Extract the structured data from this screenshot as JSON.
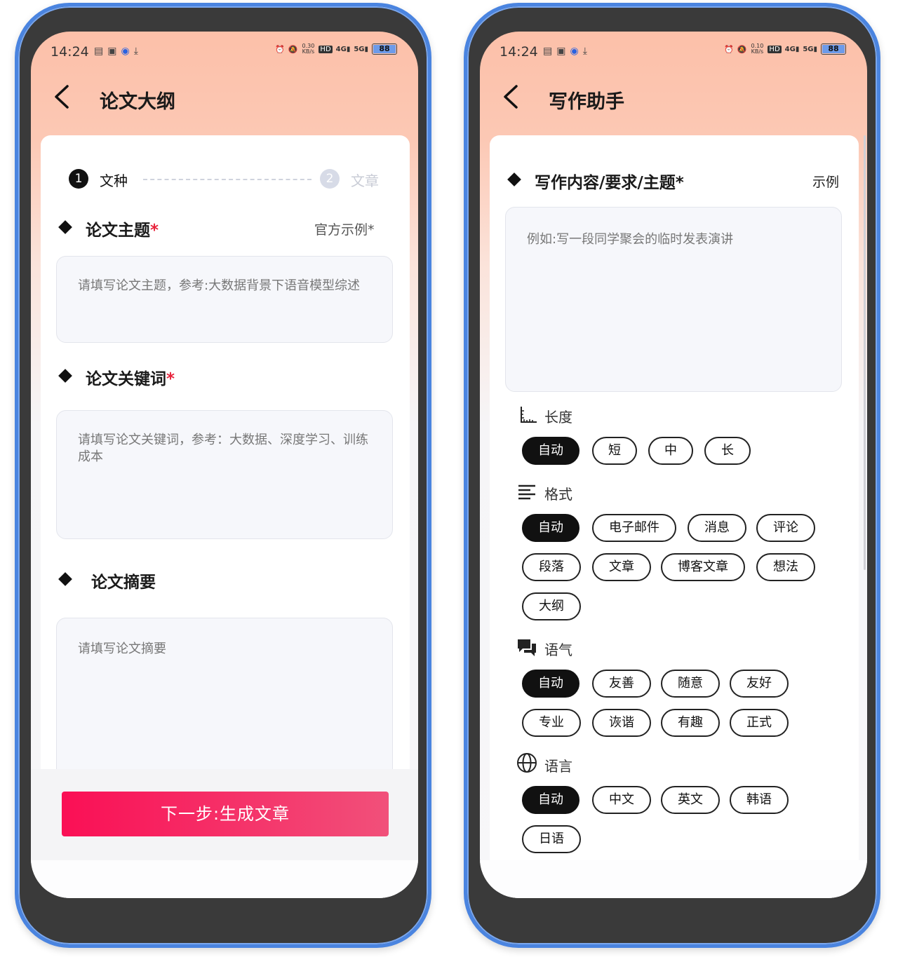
{
  "left": {
    "status": {
      "time": "14:24",
      "speed_top": "0.30",
      "speed_unit": "KB/s",
      "battery": "88"
    },
    "title": "论文大纲",
    "steps": [
      {
        "num": "1",
        "label": "文种"
      },
      {
        "num": "2",
        "label": "文章"
      }
    ],
    "topic": {
      "title": "论文主题",
      "req": "*",
      "example_link": "官方示例*",
      "placeholder": "请填写论文主题，参考:大数据背景下语音模型综述"
    },
    "keywords": {
      "title": "论文关键词",
      "req": "*",
      "placeholder": "请填写论文关键词，参考：大数据、深度学习、训练成本"
    },
    "abstract": {
      "title": "论文摘要",
      "placeholder": "请填写论文摘要"
    },
    "next_button": "下一步:生成文章"
  },
  "right": {
    "status": {
      "time": "14:24",
      "speed_top": "0.10",
      "speed_unit": "KB/s",
      "battery": "88"
    },
    "title": "写作助手",
    "content": {
      "title": "写作内容/要求/主题*",
      "example_link": "示例",
      "placeholder": "例如:写一段同学聚会的临时发表演讲"
    },
    "length": {
      "label": "长度",
      "options": [
        "自动",
        "短",
        "中",
        "长"
      ],
      "selected": "自动"
    },
    "format": {
      "label": "格式",
      "options": [
        "自动",
        "电子邮件",
        "消息",
        "评论",
        "段落",
        "文章",
        "博客文章",
        "想法",
        "大纲"
      ],
      "selected": "自动"
    },
    "tone": {
      "label": "语气",
      "options": [
        "自动",
        "友善",
        "随意",
        "友好",
        "专业",
        "诙谐",
        "有趣",
        "正式"
      ],
      "selected": "自动"
    },
    "language": {
      "label": "语言",
      "options": [
        "自动",
        "中文",
        "英文",
        "韩语",
        "日语"
      ],
      "selected": "自动"
    }
  },
  "colors": {
    "accent_start": "#fa0f55",
    "accent_end": "#f1507a",
    "header_peach": "#fcc0a9",
    "required": "#e8233c",
    "frame_blue": "#4a84e0"
  }
}
